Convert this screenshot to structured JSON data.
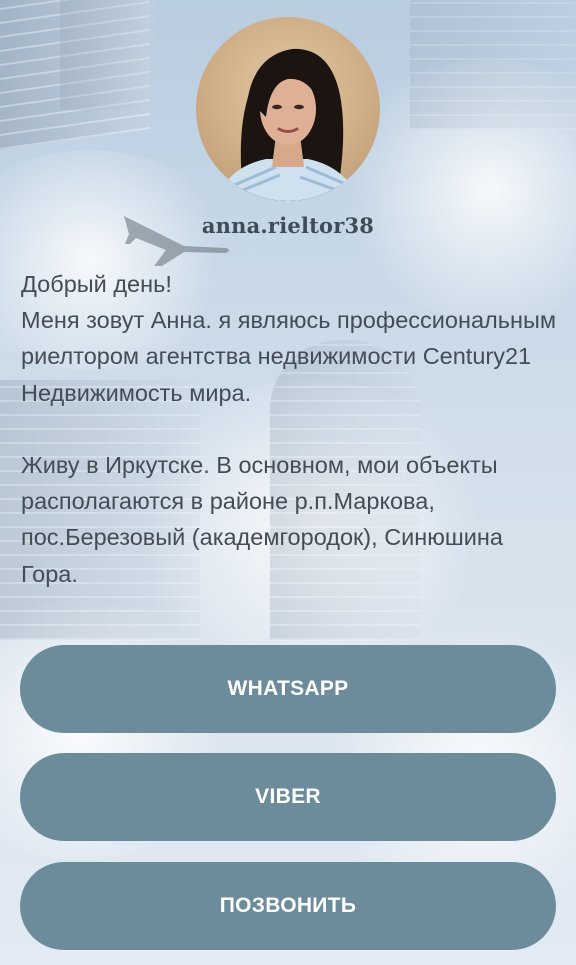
{
  "profile": {
    "username": "anna.rieltor38",
    "bio": "Добрый день!\nМеня зовут Анна. я являюсь профессиональным риелтором агентства недвижимости Century21 Недвижимость мира.\n\nЖиву в Иркутске. В основном, мои объекты располагаются в районе р.п.Маркова, пос.Березовый (академгородок), Синюшина Гора."
  },
  "buttons": {
    "whatsapp": "WHATSAPP",
    "viber": "VIBER",
    "call": "ПОЗВОНИТЬ"
  },
  "colors": {
    "button_bg": "#6c8c9b",
    "button_text": "#ffffff",
    "text": "#444c55",
    "username": "#3e4c57"
  }
}
